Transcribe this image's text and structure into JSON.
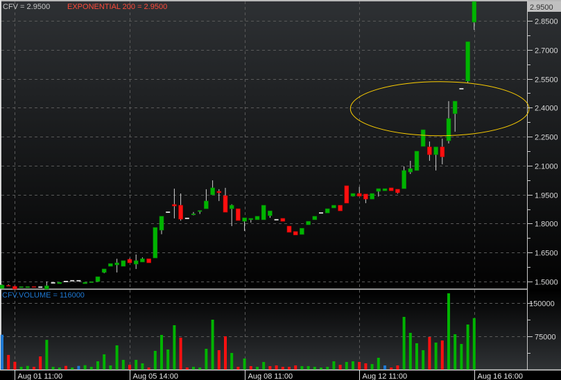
{
  "chart_data": {
    "type": "candlestick",
    "symbol_label": "CFV = 2.9500",
    "indicator_label": "EXPONENTIAL 200 = 2.9500",
    "volume_label": "CFV.VOLUME = 116000",
    "last_price_label": "2.9500",
    "price_axis": {
      "range": [
        1.468,
        2.96
      ],
      "ticks": [
        "2.8500",
        "2.7000",
        "2.5500",
        "2.4000",
        "2.2500",
        "2.1000",
        "1.9500",
        "1.8000",
        "1.6500",
        "1.5000"
      ],
      "tick_values": [
        2.85,
        2.7,
        2.55,
        2.4,
        2.25,
        2.1,
        1.95,
        1.8,
        1.65,
        1.5
      ]
    },
    "volume_axis": {
      "range": [
        0,
        180000
      ],
      "ticks": [
        "150000",
        "75000"
      ],
      "tick_values": [
        150000,
        75000
      ]
    },
    "x_ticks": [
      {
        "index": 2,
        "label": "Aug 01 11:00"
      },
      {
        "index": 20,
        "label": "Aug 05 14:00"
      },
      {
        "index": 38,
        "label": "Aug 08 11:00"
      },
      {
        "index": 56,
        "label": "Aug 12 11:00"
      },
      {
        "index": 74,
        "label": "Aug 16 16:00"
      }
    ],
    "grid": true,
    "colors": {
      "up": "#00b400",
      "down": "#ff1010",
      "flat": "#1e78d2",
      "doji": "#d0d0d0",
      "annotation": "#ffd000",
      "symbol": "#c8c8c8",
      "indicator": "#ff4a3a",
      "volume_label": "#1e78d2"
    },
    "annotation": {
      "shape": "ellipse",
      "center_index": 68.6,
      "center_price": 2.395,
      "half_width_candles": 14,
      "half_height_price": 0.14
    },
    "candles": [
      [
        1.464,
        1.486,
        1.461,
        1.482
      ],
      [
        1.478,
        1.486,
        1.475,
        1.475
      ],
      [
        1.475,
        1.478,
        1.461,
        1.461
      ],
      [
        1.47,
        1.471,
        1.47,
        1.471
      ],
      [
        1.47,
        1.471,
        1.47,
        1.471
      ],
      [
        1.472,
        1.472,
        1.471,
        1.471
      ],
      [
        1.471,
        1.471,
        1.471,
        1.471
      ],
      [
        1.461,
        1.5,
        1.461,
        1.478
      ],
      [
        1.493,
        1.493,
        1.493,
        1.493
      ],
      [
        1.489,
        1.496,
        1.489,
        1.496
      ],
      [
        1.5,
        1.5,
        1.5,
        1.5
      ],
      [
        1.504,
        1.504,
        1.504,
        1.504
      ],
      [
        1.504,
        1.504,
        1.504,
        1.504
      ],
      [
        1.489,
        1.496,
        1.489,
        1.496
      ],
      [
        1.495,
        1.497,
        1.495,
        1.497
      ],
      [
        1.5,
        1.525,
        1.5,
        1.525
      ],
      [
        1.547,
        1.565,
        1.543,
        1.565
      ],
      [
        1.579,
        1.593,
        1.579,
        1.593
      ],
      [
        1.586,
        1.618,
        1.547,
        1.597
      ],
      [
        1.579,
        1.608,
        1.579,
        1.608
      ],
      [
        1.615,
        1.62,
        1.597,
        1.597
      ],
      [
        1.59,
        1.64,
        1.565,
        1.608
      ],
      [
        1.601,
        1.625,
        1.601,
        1.618
      ],
      [
        1.618,
        1.618,
        1.597,
        1.597
      ],
      [
        1.622,
        1.78,
        1.622,
        1.78
      ],
      [
        1.766,
        1.838,
        1.745,
        1.838
      ],
      [
        1.859,
        1.859,
        1.859,
        1.859
      ],
      [
        1.899,
        1.981,
        1.827,
        1.891
      ],
      [
        1.895,
        1.956,
        1.815,
        1.823
      ],
      [
        1.827,
        1.827,
        1.827,
        1.827
      ],
      [
        1.843,
        1.86,
        1.843,
        1.848
      ],
      [
        1.861,
        1.865,
        1.85,
        1.865
      ],
      [
        1.877,
        1.978,
        1.877,
        1.917
      ],
      [
        1.949,
        2.024,
        1.949,
        1.985
      ],
      [
        1.967,
        1.978,
        1.917,
        1.96
      ],
      [
        1.945,
        1.985,
        1.859,
        1.859
      ],
      [
        1.877,
        1.9,
        1.787,
        1.895
      ],
      [
        1.877,
        1.877,
        1.816,
        1.816
      ],
      [
        1.812,
        1.83,
        1.762,
        1.83
      ],
      [
        1.82,
        1.827,
        1.805,
        1.827
      ],
      [
        1.82,
        1.838,
        1.82,
        1.838
      ],
      [
        1.82,
        1.895,
        1.82,
        1.895
      ],
      [
        1.841,
        1.866,
        1.83,
        1.866
      ],
      [
        1.82,
        1.82,
        1.82,
        1.82
      ],
      [
        1.827,
        1.827,
        1.812,
        1.812
      ],
      [
        1.787,
        1.787,
        1.755,
        1.755
      ],
      [
        1.759,
        1.759,
        1.741,
        1.741
      ],
      [
        1.744,
        1.776,
        1.744,
        1.776
      ],
      [
        1.794,
        1.812,
        1.794,
        1.812
      ],
      [
        1.82,
        1.838,
        1.82,
        1.838
      ],
      [
        1.855,
        1.855,
        1.855,
        1.855
      ],
      [
        1.855,
        1.877,
        1.855,
        1.877
      ],
      [
        1.881,
        1.895,
        1.881,
        1.895
      ],
      [
        1.895,
        1.895,
        1.866,
        1.866
      ],
      [
        1.996,
        1.996,
        1.906,
        1.906
      ],
      [
        1.942,
        1.956,
        1.94,
        1.956
      ],
      [
        1.956,
        1.99,
        1.942,
        1.942
      ],
      [
        1.953,
        1.953,
        1.906,
        1.927
      ],
      [
        1.927,
        1.956,
        1.927,
        1.956
      ],
      [
        1.967,
        1.981,
        1.94,
        1.981
      ],
      [
        1.97,
        1.981,
        1.97,
        1.981
      ],
      [
        1.985,
        1.985,
        1.97,
        1.97
      ],
      [
        1.978,
        1.978,
        1.955,
        1.96
      ],
      [
        1.981,
        2.096,
        1.981,
        2.075
      ],
      [
        2.067,
        2.125,
        2.057,
        2.085
      ],
      [
        2.075,
        2.175,
        2.075,
        2.175
      ],
      [
        2.2,
        2.286,
        2.2,
        2.286
      ],
      [
        2.197,
        2.225,
        2.125,
        2.157
      ],
      [
        2.157,
        2.197,
        2.075,
        2.197
      ],
      [
        2.197,
        2.24,
        2.107,
        2.146
      ],
      [
        2.229,
        2.434,
        2.215,
        2.344
      ],
      [
        2.369,
        2.434,
        2.276,
        2.434
      ],
      [
        2.498,
        2.498,
        2.498,
        2.498
      ],
      [
        2.538,
        2.742,
        2.53,
        2.742
      ],
      [
        2.843,
        2.95,
        2.803,
        2.95
      ]
    ],
    "volumes": [
      78600,
      33000,
      17600,
      6200,
      8300,
      6200,
      29700,
      67000,
      6200,
      4700,
      8300,
      4700,
      8300,
      9900,
      6200,
      18700,
      34400,
      9400,
      54700,
      21900,
      10900,
      21900,
      14100,
      4700,
      42200,
      78100,
      45300,
      100000,
      71900,
      4700,
      6200,
      4700,
      46900,
      112500,
      43700,
      75000,
      37500,
      6200,
      25000,
      7800,
      6200,
      17200,
      7800,
      9400,
      6200,
      6200,
      9400,
      7800,
      7800,
      6200,
      4700,
      6200,
      18700,
      10900,
      17200,
      18700,
      17200,
      14100,
      12500,
      26600,
      9400,
      4700,
      9400,
      118800,
      82800,
      59400,
      43700,
      73400,
      60900,
      65600,
      171900,
      79700,
      57800,
      101600,
      116000
    ],
    "volume_direction": [
      "flat",
      "down",
      "down",
      "up",
      "up",
      "down",
      "down",
      "up",
      "up",
      "up",
      "down",
      "up",
      "flat",
      "up",
      "up",
      "up",
      "up",
      "up",
      "up",
      "up",
      "down",
      "up",
      "up",
      "down",
      "up",
      "up",
      "up",
      "up",
      "down",
      "down",
      "up",
      "up",
      "up",
      "up",
      "down",
      "down",
      "up",
      "down",
      "up",
      "down",
      "up",
      "up",
      "down",
      "down",
      "down",
      "down",
      "down",
      "up",
      "up",
      "up",
      "up",
      "up",
      "up",
      "down",
      "up",
      "up",
      "down",
      "down",
      "up",
      "up",
      "flat",
      "down",
      "down",
      "up",
      "up",
      "up",
      "up",
      "down",
      "up",
      "down",
      "up",
      "up",
      "up",
      "up",
      "up"
    ]
  }
}
